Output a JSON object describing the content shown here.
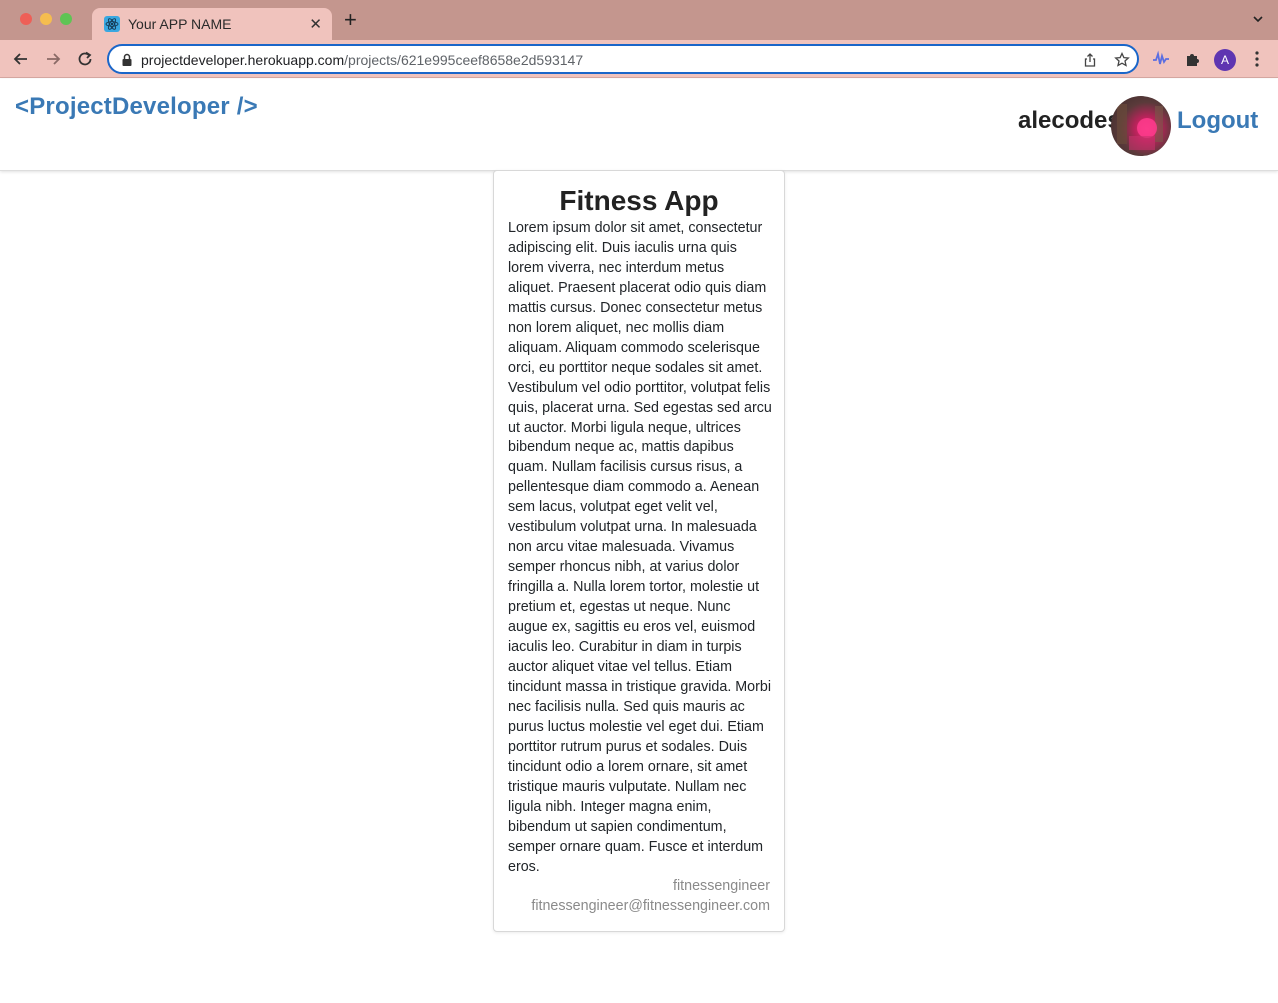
{
  "browser": {
    "tab_title": "Your APP NAME",
    "new_tab_label": "+",
    "close_label": "✕",
    "url_host": "projectdeveloper.herokuapp.com",
    "url_path": "/projects/621e995ceef8658e2d593147",
    "profile_initial": "A"
  },
  "header": {
    "brand": "<ProjectDeveloper />",
    "username": "alecodes",
    "logout_label": "Logout"
  },
  "project": {
    "title": "Fitness App",
    "description": "Lorem ipsum dolor sit amet, consectetur adipiscing elit. Duis iaculis urna quis lorem viverra, nec interdum metus aliquet. Praesent placerat odio quis diam mattis cursus. Donec consectetur metus non lorem aliquet, nec mollis diam aliquam. Aliquam commodo scelerisque orci, eu porttitor neque sodales sit amet. Vestibulum vel odio porttitor, volutpat felis quis, placerat urna. Sed egestas sed arcu ut auctor. Morbi ligula neque, ultrices bibendum neque ac, mattis dapibus quam. Nullam facilisis cursus risus, a pellentesque diam commodo a. Aenean sem lacus, volutpat eget velit vel, vestibulum volutpat urna. In malesuada non arcu vitae malesuada. Vivamus semper rhoncus nibh, at varius dolor fringilla a. Nulla lorem tortor, molestie ut pretium et, egestas ut neque. Nunc augue ex, sagittis eu eros vel, euismod iaculis leo. Curabitur in diam in turpis auctor aliquet vitae vel tellus. Etiam tincidunt massa in tristique gravida. Morbi nec facilisis nulla. Sed quis mauris ac purus luctus molestie vel eget dui. Etiam porttitor rutrum purus et sodales. Duis tincidunt odio a lorem ornare, sit amet tristique mauris vulputate. Nullam nec ligula nibh. Integer magna enim, bibendum ut sapien condimentum, semper ornare quam. Fusce et interdum eros.",
    "author": "fitnessengineer",
    "email": "fitnessengineer@fitnessengineer.com"
  },
  "colors": {
    "brand_blue": "#3a79b5",
    "tabbar": "#c4968e",
    "toolbar": "#f0c3bd"
  },
  "icons": [
    "react-favicon-icon",
    "back-icon",
    "forward-icon",
    "reload-icon",
    "lock-icon",
    "share-icon",
    "star-icon",
    "extension-wave-icon",
    "puzzle-icon",
    "kebab-menu-icon",
    "tab-list-chevron-icon"
  ]
}
